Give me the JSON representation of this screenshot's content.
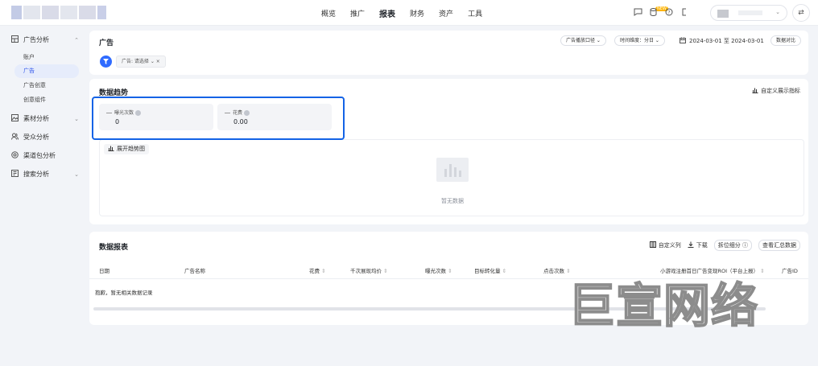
{
  "nav": {
    "items": [
      "概览",
      "推广",
      "报表",
      "财务",
      "资产",
      "工具"
    ],
    "active": "报表"
  },
  "topbar": {
    "badge": "NEW"
  },
  "sidebar": {
    "group_ad": "广告分析",
    "sub_account": "账户",
    "sub_ad": "广告",
    "sub_creative": "广告创意",
    "sub_component": "创意组件",
    "group_material": "素材分析",
    "group_audience": "受众分析",
    "group_channel": "渠道包分析",
    "group_search": "搜索分析"
  },
  "header": {
    "title": "广告",
    "placement_select": "广告播放口径 ⌄",
    "granularity_select": "时间维度：分日 ⌄",
    "date_range": "2024-03-01 至 2024-03-01",
    "compare_button": "数据对比",
    "filter_tag": "广告: 请选择 ⌄ ×"
  },
  "trend": {
    "title": "数据趋势",
    "custom_metric": "自定义展示指标",
    "metrics": [
      {
        "label": "曝光次数",
        "value": "0"
      },
      {
        "label": "花费",
        "value": "0.00"
      }
    ],
    "expand_button": "展开趋势图",
    "empty_text": "暂无数据"
  },
  "report": {
    "title": "数据报表",
    "tool_custom_columns": "自定义列",
    "tool_download": "下载",
    "tool_split": "拆位细分",
    "tool_summary": "查看汇总数据",
    "columns": [
      "日期",
      "广告名称",
      "花费",
      "千次展现均价",
      "曝光次数",
      "目标转化量",
      "点击次数",
      "小游戏注册首日广告变现ROI（平台上报）",
      "广告ID"
    ],
    "empty_row": "抱歉，暂无相关数据记录"
  },
  "watermark": {
    "text": "巨宣网络"
  },
  "colors": {
    "accent": "#2f6bff",
    "highlight_border": "#1463e6",
    "active_bg": "#e6ecfb"
  }
}
